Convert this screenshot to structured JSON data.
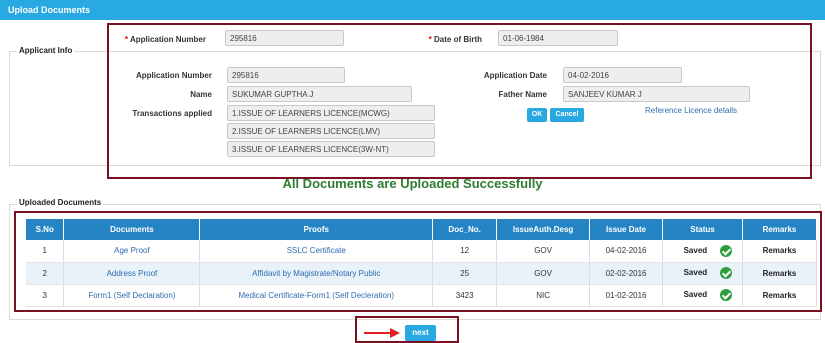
{
  "header": {
    "title": "Upload Documents"
  },
  "applicant_info": {
    "legend": "Applicant Info",
    "search": {
      "app_number_label": "Application Number",
      "app_number_value": "295816",
      "dob_label": "Date of Birth",
      "dob_value": "01-06-1984"
    },
    "details": {
      "app_number_label": "Application Number",
      "app_number_value": "295816",
      "app_date_label": "Application Date",
      "app_date_value": "04-02-2016",
      "name_label": "Name",
      "name_value": "SUKUMAR GUPTHA J",
      "father_label": "Father Name",
      "father_value": "SANJEEV KUMAR J",
      "transactions_label": "Transactions applied",
      "transactions": [
        "1.ISSUE OF LEARNERS LICENCE(MCWG)",
        "2.ISSUE OF LEARNERS LICENCE(LMV)",
        "3.ISSUE OF LEARNERS LICENCE(3W-NT)"
      ],
      "ok_label": "OK",
      "cancel_label": "Cancel",
      "reference_link": "Reference Licence details"
    }
  },
  "success_message": "All Documents are Uploaded Successfully",
  "uploaded": {
    "legend": "Uploaded Documents",
    "columns": [
      "S.No",
      "Documents",
      "Proofs",
      "Doc_No.",
      "IssueAuth.Desg",
      "Issue  Date",
      "Status",
      "Remarks"
    ],
    "rows": [
      {
        "sno": "1",
        "document": "Age Proof",
        "proof": "SSLC Certificate",
        "doc_no": "12",
        "auth": "GOV",
        "date": "04-02-2016",
        "status": "Saved",
        "remarks": "Remarks"
      },
      {
        "sno": "2",
        "document": "Address Proof",
        "proof": "Affidavit by Magistrate/Notary Public",
        "doc_no": "25",
        "auth": "GOV",
        "date": "02-02-2016",
        "status": "Saved",
        "remarks": "Remarks"
      },
      {
        "sno": "3",
        "document": "Form1 (Self Declaration)",
        "proof": "Medical Certificate-Form1 (Self Decleration)",
        "doc_no": "3423",
        "auth": "NIC",
        "date": "01-02-2016",
        "status": "Saved",
        "remarks": "Remarks"
      }
    ]
  },
  "next_label": "next",
  "colors": {
    "accent": "#29a9e1",
    "table_header": "#2585c4",
    "highlight_border": "#7b1020",
    "success": "#2e7d32",
    "arrow": "#e02020"
  }
}
